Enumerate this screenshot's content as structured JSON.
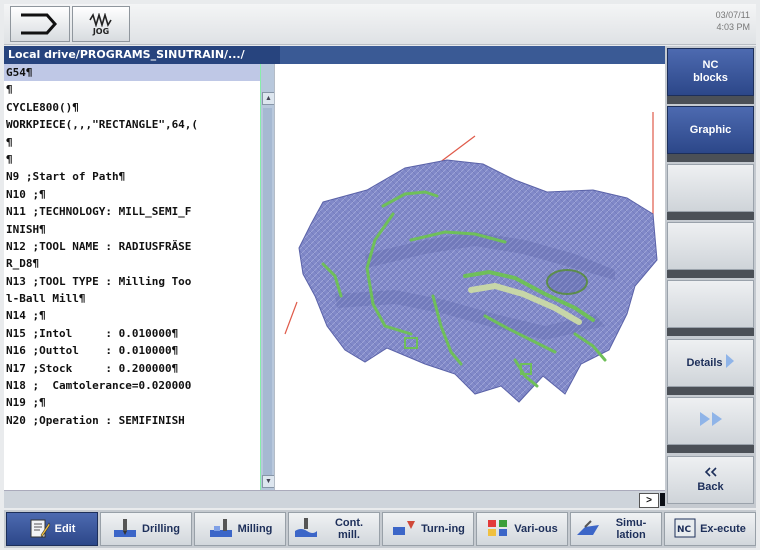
{
  "header": {
    "jog_label": "JOG",
    "datetime_line1": "03/07/11",
    "datetime_line2": "4:03 PM"
  },
  "path": "Local drive/PROGRAMS_SINUTRAIN/.../",
  "editor_lines": [
    {
      "text": "G54¶",
      "selected": true
    },
    {
      "text": "¶"
    },
    {
      "text": "CYCLE800()¶"
    },
    {
      "text": "WORKPIECE(,,,\"RECTANGLE\",64,("
    },
    {
      "text": "¶"
    },
    {
      "text": "¶"
    },
    {
      "text": "N9 ;Start of Path¶"
    },
    {
      "text": "N10 ;¶"
    },
    {
      "text": "N11 ;TECHNOLOGY: MILL_SEMI_F"
    },
    {
      "text": "INISH¶"
    },
    {
      "text": "N12 ;TOOL NAME : RADIUSFRÄSE"
    },
    {
      "text": "R_D8¶"
    },
    {
      "text": "N13 ;TOOL TYPE : Milling Too"
    },
    {
      "text": "l-Ball Mill¶"
    },
    {
      "text": "N14 ;¶"
    },
    {
      "text": "N15 ;Intol     : 0.010000¶"
    },
    {
      "text": "N16 ;Outtol    : 0.010000¶"
    },
    {
      "text": "N17 ;Stock     : 0.200000¶"
    },
    {
      "text": "N18 ;  Camtolerance=0.020000"
    },
    {
      "text": "N19 ;¶"
    },
    {
      "text": "N20 ;Operation : SEMIFINISH"
    }
  ],
  "scroll_right_label": ">",
  "right_softkeys": [
    {
      "label": "NC blocks",
      "style": "blue"
    },
    {
      "label": "Graphic",
      "style": "blue"
    },
    {
      "label": "",
      "style": "normal"
    },
    {
      "label": "",
      "style": "normal"
    },
    {
      "label": "",
      "style": "normal"
    },
    {
      "label": "Details",
      "style": "normal",
      "icon": "arrow-right-icon"
    },
    {
      "label": "",
      "style": "normal",
      "icon": "double-arrow-right-icon"
    },
    {
      "label": "Back",
      "style": "normal",
      "icon": "double-chevron-left-icon"
    }
  ],
  "bottom_softkeys": [
    {
      "label": "Edit",
      "icon": "edit-icon",
      "active": true
    },
    {
      "label": "Drilling",
      "icon": "drilling-icon"
    },
    {
      "label": "Milling",
      "icon": "milling-icon"
    },
    {
      "label": "Cont. mill.",
      "icon": "contour-milling-icon"
    },
    {
      "label": "Turn-ing",
      "icon": "turning-icon"
    },
    {
      "label": "Vari-ous",
      "icon": "various-icon"
    },
    {
      "label": "Simu-lation",
      "icon": "simulation-icon"
    },
    {
      "label": "Ex-ecute",
      "icon": "nc-execute-icon"
    }
  ],
  "colors": {
    "accent_blue": "#2c4789",
    "part_blue": "#7f87c9",
    "toolpath_green": "#6fbf5a",
    "axis_red": "#e05a4a"
  }
}
